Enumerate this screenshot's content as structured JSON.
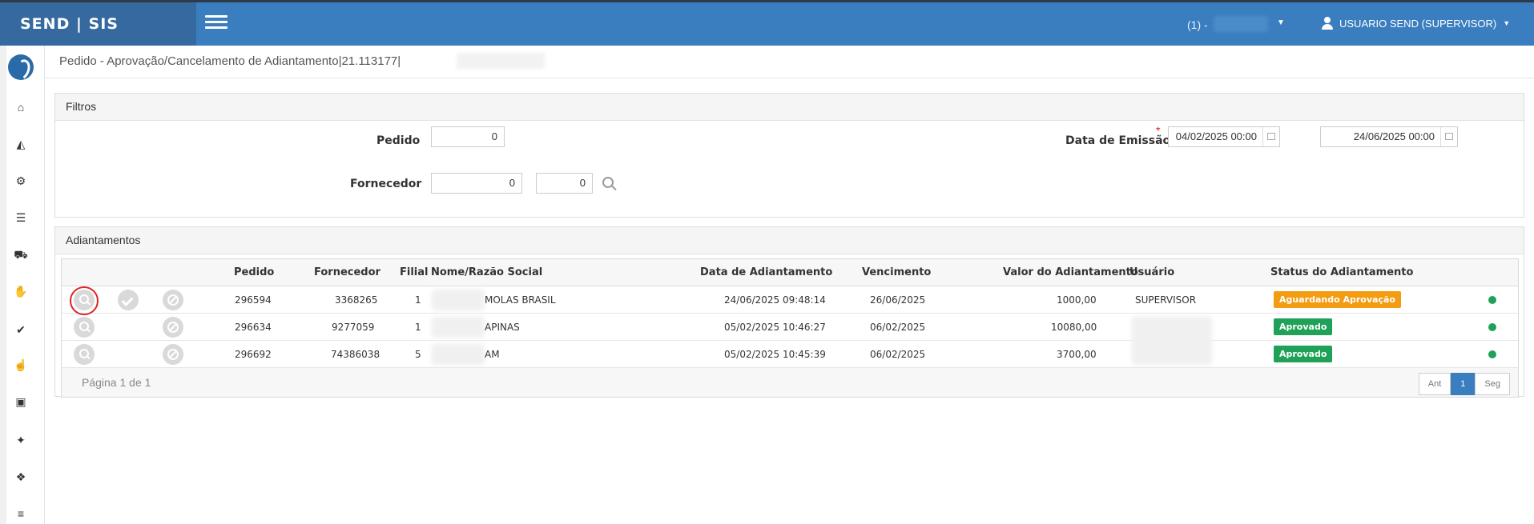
{
  "app": {
    "brand": "SEND | SIS"
  },
  "header": {
    "branch_label": "(1) -",
    "user_label": "USUARIO SEND (SUPERVISOR)"
  },
  "sidebar": {
    "icons": [
      "home-icon",
      "chart-icon",
      "cogs-icon",
      "tasks-icon",
      "cart-icon",
      "thumbs-up-filled-icon",
      "check-circle-icon",
      "thumbs-up-icon",
      "money-icon",
      "handshake-icon",
      "cubes-icon",
      "database-icon"
    ]
  },
  "breadcrumb": "Pedido - Aprovação/Cancelamento de Adiantamento|21.113177|",
  "filters": {
    "title": "Filtros",
    "pedido_label": "Pedido",
    "pedido_value": "0",
    "fornecedor_label": "Fornecedor",
    "fornecedor_value1": "0",
    "fornecedor_value2": "0",
    "data_label": "Data de Emissão",
    "required_mark": "*",
    "data_inicio": "04/02/2025 00:00",
    "data_fim": "24/06/2025 00:00"
  },
  "adiantamentos": {
    "title": "Adiantamentos",
    "columns": {
      "pedido": "Pedido",
      "fornecedor": "Fornecedor",
      "filial": "Filial",
      "nome": "Nome/Razão Social",
      "data": "Data de Adiantamento",
      "vencimento": "Vencimento",
      "valor": "Valor do Adiantamento",
      "usuario": "Usuário",
      "status": "Status do Adiantamento"
    },
    "rows": [
      {
        "pedido": "296594",
        "fornecedor": "3368265",
        "filial": "1",
        "nome": "MOLAS BRASIL",
        "data": "24/06/2025 09:48:14",
        "vencimento": "26/06/2025",
        "valor": "1000,00",
        "usuario": "SUPERVISOR",
        "status": "Aguardando Aprovação",
        "status_color": "#f39c12"
      },
      {
        "pedido": "296634",
        "fornecedor": "9277059",
        "filial": "1",
        "nome": "APINAS",
        "data": "05/02/2025 10:46:27",
        "vencimento": "06/02/2025",
        "valor": "10080,00",
        "usuario": "",
        "status": "Aprovado",
        "status_color": "#1fa257"
      },
      {
        "pedido": "296692",
        "fornecedor": "74386038",
        "filial": "5",
        "nome": "AM",
        "data": "05/02/2025 10:45:39",
        "vencimento": "06/02/2025",
        "valor": "3700,00",
        "usuario": "",
        "status": "Aprovado",
        "status_color": "#1fa257"
      }
    ],
    "page_info": "Página 1 de 1",
    "pager": {
      "prev": "Ant",
      "current": "1",
      "next": "Seg"
    }
  }
}
